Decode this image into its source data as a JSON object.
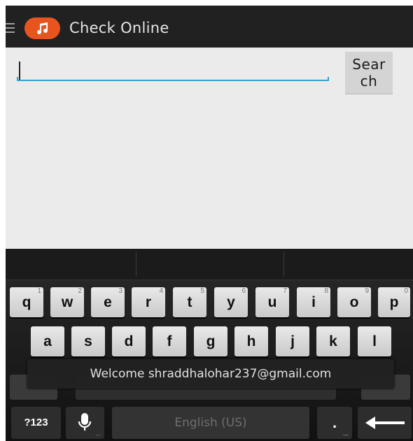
{
  "app": {
    "title": "Check Online",
    "icon": "music-note-icon",
    "accent_color": "#e8541e"
  },
  "search": {
    "value": "",
    "button_label": "Search"
  },
  "keyboard": {
    "row1": [
      {
        "key": "q",
        "hint": "1"
      },
      {
        "key": "w",
        "hint": "2"
      },
      {
        "key": "e",
        "hint": "3"
      },
      {
        "key": "r",
        "hint": "4"
      },
      {
        "key": "t",
        "hint": "5"
      },
      {
        "key": "y",
        "hint": "6"
      },
      {
        "key": "u",
        "hint": "7"
      },
      {
        "key": "i",
        "hint": "8"
      },
      {
        "key": "o",
        "hint": "9"
      },
      {
        "key": "p",
        "hint": "0"
      }
    ],
    "row2": [
      "a",
      "s",
      "d",
      "f",
      "g",
      "h",
      "j",
      "k",
      "l"
    ],
    "symbols_label": "?123",
    "space_label": "English (US)",
    "period_label": ".",
    "mic_icon": "microphone-icon",
    "enter_icon": "enter-arrow-icon"
  },
  "toast": {
    "message": "Welcome shraddhalohar237@gmail.com"
  }
}
